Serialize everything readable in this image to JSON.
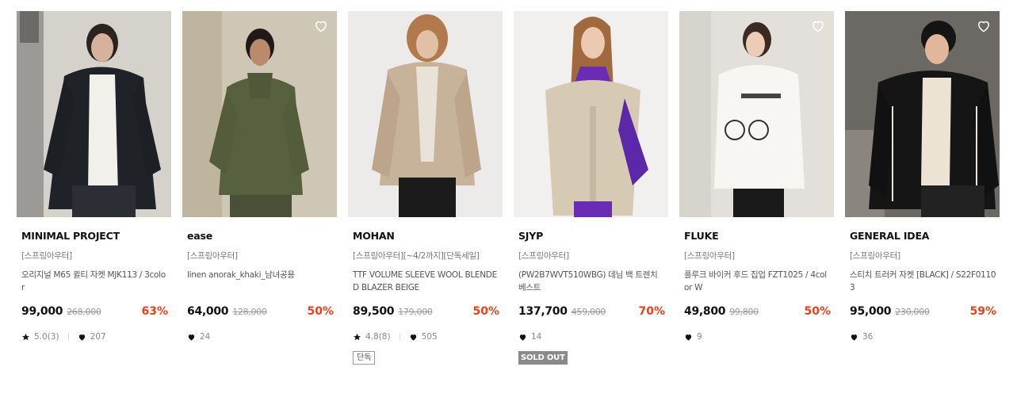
{
  "products": [
    {
      "brand": "MINIMAL PROJECT",
      "category": "[스프링아우터]",
      "name": "오리지널 M65 퀼티 자켓 MJK113 / 3color",
      "price": "99,000",
      "original_price": "268,000",
      "discount": "63%",
      "rating": "5.0(3)",
      "likes": "207",
      "badge": "",
      "show_wish_icon": false
    },
    {
      "brand": "ease",
      "category": "[스프링아우터]",
      "name": "linen anorak_khaki_남녀공용",
      "price": "64,000",
      "original_price": "128,000",
      "discount": "50%",
      "rating": "",
      "likes": "24",
      "badge": "",
      "show_wish_icon": true
    },
    {
      "brand": "MOHAN",
      "category": "[스프링아우터][~4/2까지][단독세일]",
      "name": "TTF VOLUME SLEEVE WOOL BLENDED BLAZER BEIGE",
      "price": "89,500",
      "original_price": "179,000",
      "discount": "50%",
      "rating": "4.8(8)",
      "likes": "505",
      "badge": "단독",
      "show_wish_icon": false
    },
    {
      "brand": "SJYP",
      "category": "[스프링아우터]",
      "name": "(PW2B7WVT510WBG) 데님 백 트렌치 베스트",
      "price": "137,700",
      "original_price": "459,000",
      "discount": "70%",
      "rating": "",
      "likes": "14",
      "badge": "SOLD OUT",
      "show_wish_icon": false
    },
    {
      "brand": "FLUKE",
      "category": "[스프링아우터]",
      "name": "플루크 바이커 후드 집업 FZT1025 / 4color W",
      "price": "49,800",
      "original_price": "99,800",
      "discount": "50%",
      "rating": "",
      "likes": "9",
      "badge": "",
      "show_wish_icon": true
    },
    {
      "brand": "GENERAL IDEA",
      "category": "[스프링아우터]",
      "name": "스티치 트러커 자켓 [BLACK] / S22F01103",
      "price": "95,000",
      "original_price": "230,000",
      "discount": "59%",
      "rating": "",
      "likes": "36",
      "badge": "",
      "show_wish_icon": true
    }
  ],
  "colors": {
    "discount": "#e8411b",
    "soldout_bg": "#8a8a8a"
  },
  "icons": {
    "wish": "heart-outline-icon",
    "rating": "star-icon",
    "likes": "heart-filled-icon"
  }
}
